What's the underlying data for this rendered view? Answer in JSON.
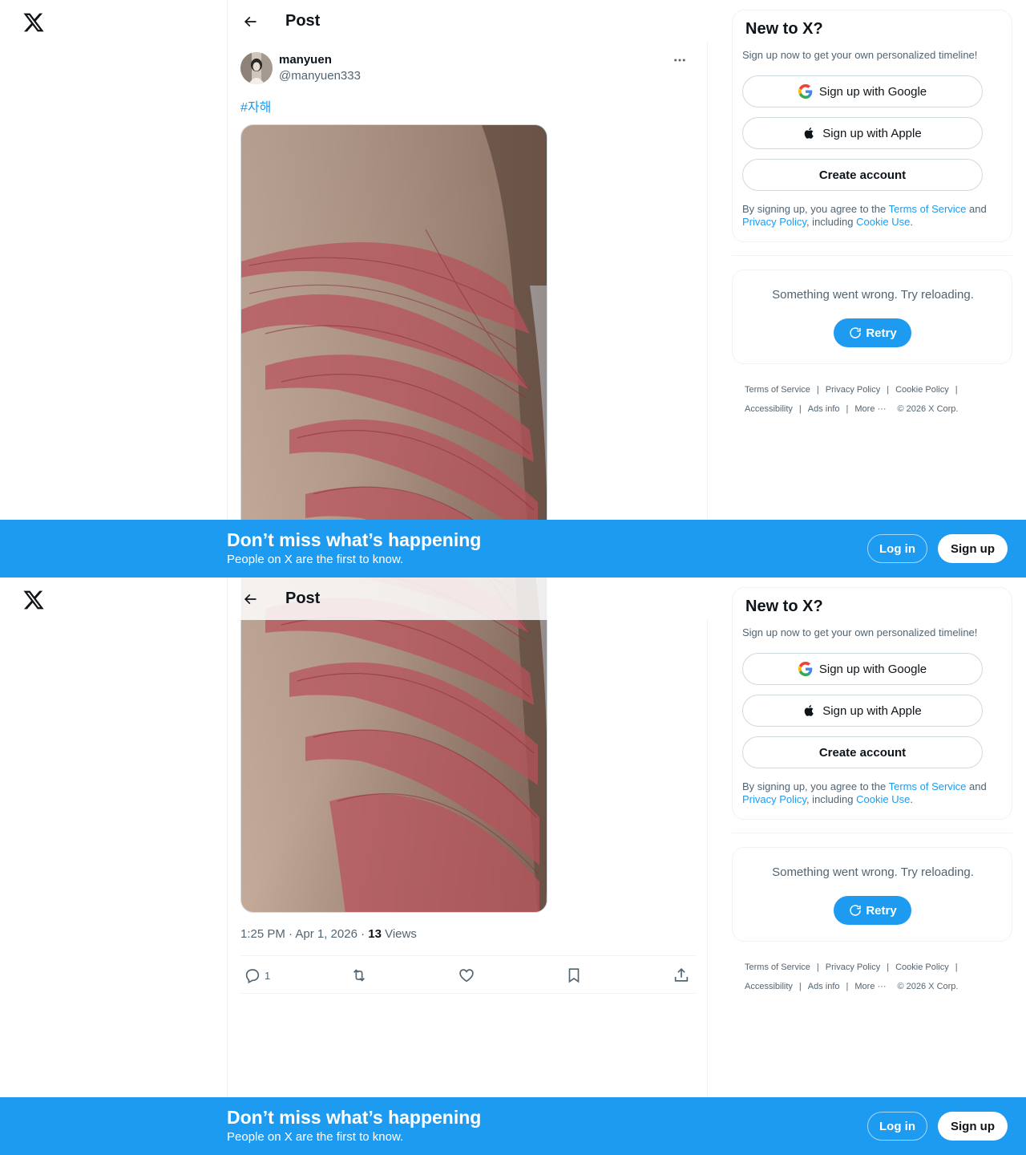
{
  "header": {
    "title": "Post"
  },
  "post": {
    "author_name": "manyuen",
    "author_handle": "@manyuen333",
    "hashtag": "#자해",
    "time": "1:25 PM · Apr 1, 2026 · ",
    "views_count": "13",
    "views_label": " Views",
    "replies": "1"
  },
  "signup": {
    "title": "New to X?",
    "subtitle": "Sign up now to get your own personalized timeline!",
    "google": "Sign up with Google",
    "apple": "Sign up with Apple",
    "create": "Create account",
    "terms_prefix": "By signing up, you agree to the ",
    "terms_link": "Terms of Service",
    "terms_and": " and ",
    "privacy_link": "Privacy Policy",
    "terms_including": ", including ",
    "cookie_link": "Cookie Use",
    "terms_end": "."
  },
  "error": {
    "message": "Something went wrong. Try reloading.",
    "retry": "Retry"
  },
  "footer": {
    "tos": "Terms of Service",
    "privacy": "Privacy Policy",
    "cookie": "Cookie Policy",
    "accessibility": "Accessibility",
    "ads": "Ads info",
    "more": "More ···",
    "copyright": "© 2026 X Corp."
  },
  "banner": {
    "title": "Don’t miss what’s happening",
    "subtitle": "People on X are the first to know.",
    "login": "Log in",
    "signup": "Sign up"
  },
  "colors": {
    "accent": "#1d9bf0",
    "text": "#0f1419",
    "secondary": "#536471",
    "border": "#eff3f4"
  },
  "icons": {
    "logo": "x-logo-icon",
    "back": "arrow-left-icon",
    "more": "more-horizontal-icon",
    "reply": "reply-icon",
    "repost": "repost-icon",
    "like": "heart-icon",
    "bookmark": "bookmark-icon",
    "share": "share-icon",
    "google": "google-icon",
    "apple": "apple-icon",
    "retry": "refresh-icon"
  }
}
